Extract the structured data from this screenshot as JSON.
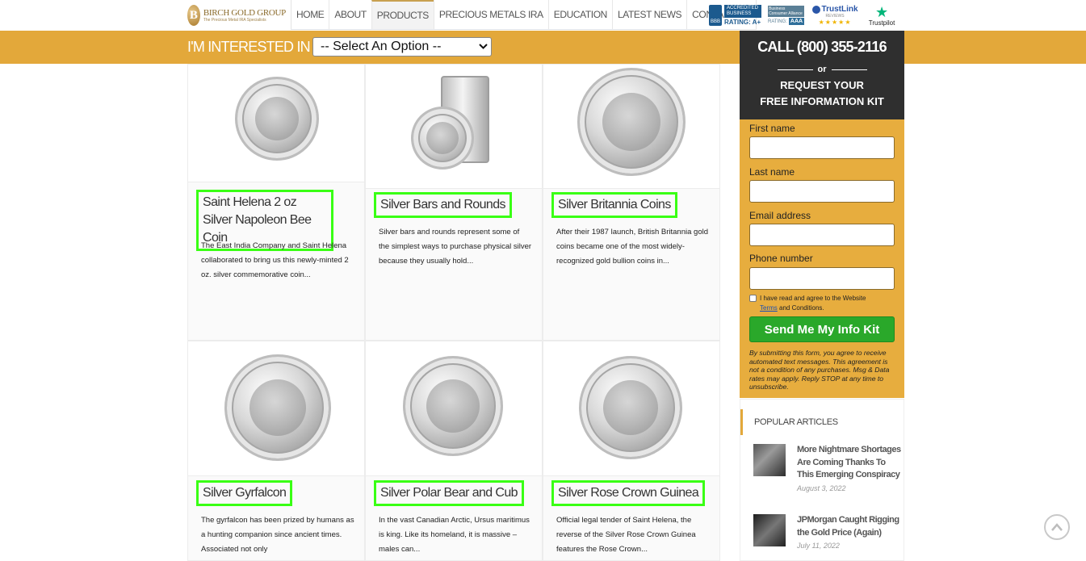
{
  "header": {
    "logo_letter": "B",
    "logo_name": "BIRCH GOLD GROUP",
    "logo_tagline": "The Precious Metal IRA Specialists",
    "nav": [
      "HOME",
      "ABOUT",
      "PRODUCTS",
      "PRECIOUS METALS IRA",
      "EDUCATION",
      "LATEST NEWS",
      "CONTACT US"
    ],
    "active_nav": "PRODUCTS",
    "badges": {
      "bbb_seal": "BBB",
      "bbb_top": "ACCREDITED BUSINESS",
      "bbb_rating": "RATING: A+",
      "bca_top": "Business Consumer Alliance",
      "bca_rating": "RATING:",
      "bca_grade": "AAA",
      "trustlink_name": "TrustLink",
      "trustlink_sub": "REVIEWS",
      "trustlink_stars": "★★★★★",
      "trustpilot_label": "Trustpilot"
    }
  },
  "interest_bar": {
    "label": "I'M INTERESTED IN >",
    "select_value": "-- Select An Option --"
  },
  "products": [
    {
      "title": "Saint Helena 2 oz Silver Napoleon Bee Coin",
      "description": "The East India Company and Saint Helena collaborated to bring us this newly-minted 2 oz. silver commemorative coin..."
    },
    {
      "title": "Silver Bars and Rounds",
      "description": "Silver bars and rounds represent some of the simplest ways to purchase physical silver because they usually hold..."
    },
    {
      "title": "Silver Britannia Coins",
      "description": "After their 1987 launch, British Britannia gold coins became one of the most widely-recognized gold bullion coins in..."
    },
    {
      "title": "Silver Gyrfalcon",
      "description": "The gyrfalcon has been prized by humans as a hunting companion since ancient times. Associated not only"
    },
    {
      "title": "Silver Polar Bear and Cub",
      "description": "In the vast Canadian Arctic, Ursus maritimus is king. Like its homeland, it is massive – males can..."
    },
    {
      "title": "Silver Rose Crown Guinea",
      "description": "Official legal tender of Saint Helena, the reverse of the Silver Rose Crown Guinea features the Rose Crown..."
    }
  ],
  "sidebar": {
    "call": "CALL (800) 355-2116",
    "or": "or",
    "request_line1": "REQUEST YOUR",
    "request_line2": "FREE INFORMATION KIT",
    "fields": [
      "First name",
      "Last name",
      "Email address",
      "Phone number"
    ],
    "agree_pre": "I have read and agree to the Website",
    "agree_link": "Terms",
    "agree_post": "and Conditions.",
    "submit": "Send Me My Info Kit",
    "disclaimer": "By submitting this form, you agree to receive automated text messages. This agreement is not a condition of any purchases. Msg & Data rates may apply. Reply STOP at any time to unsubscribe."
  },
  "popular": {
    "heading": "POPULAR ARTICLES",
    "articles": [
      {
        "title": "More Nightmare Shortages Are Coming Thanks To This Emerging Conspiracy",
        "date": "August 3, 2022"
      },
      {
        "title": "JPMorgan Caught Rigging the Gold Price (Again)",
        "date": "July 11, 2022"
      }
    ]
  },
  "colors": {
    "accent": "#e3a83a",
    "highlight": "#39ff14",
    "dark": "#2f2f2f",
    "button": "#2aa82a"
  },
  "icons": {
    "scroll_top": "chevron-up-icon"
  }
}
